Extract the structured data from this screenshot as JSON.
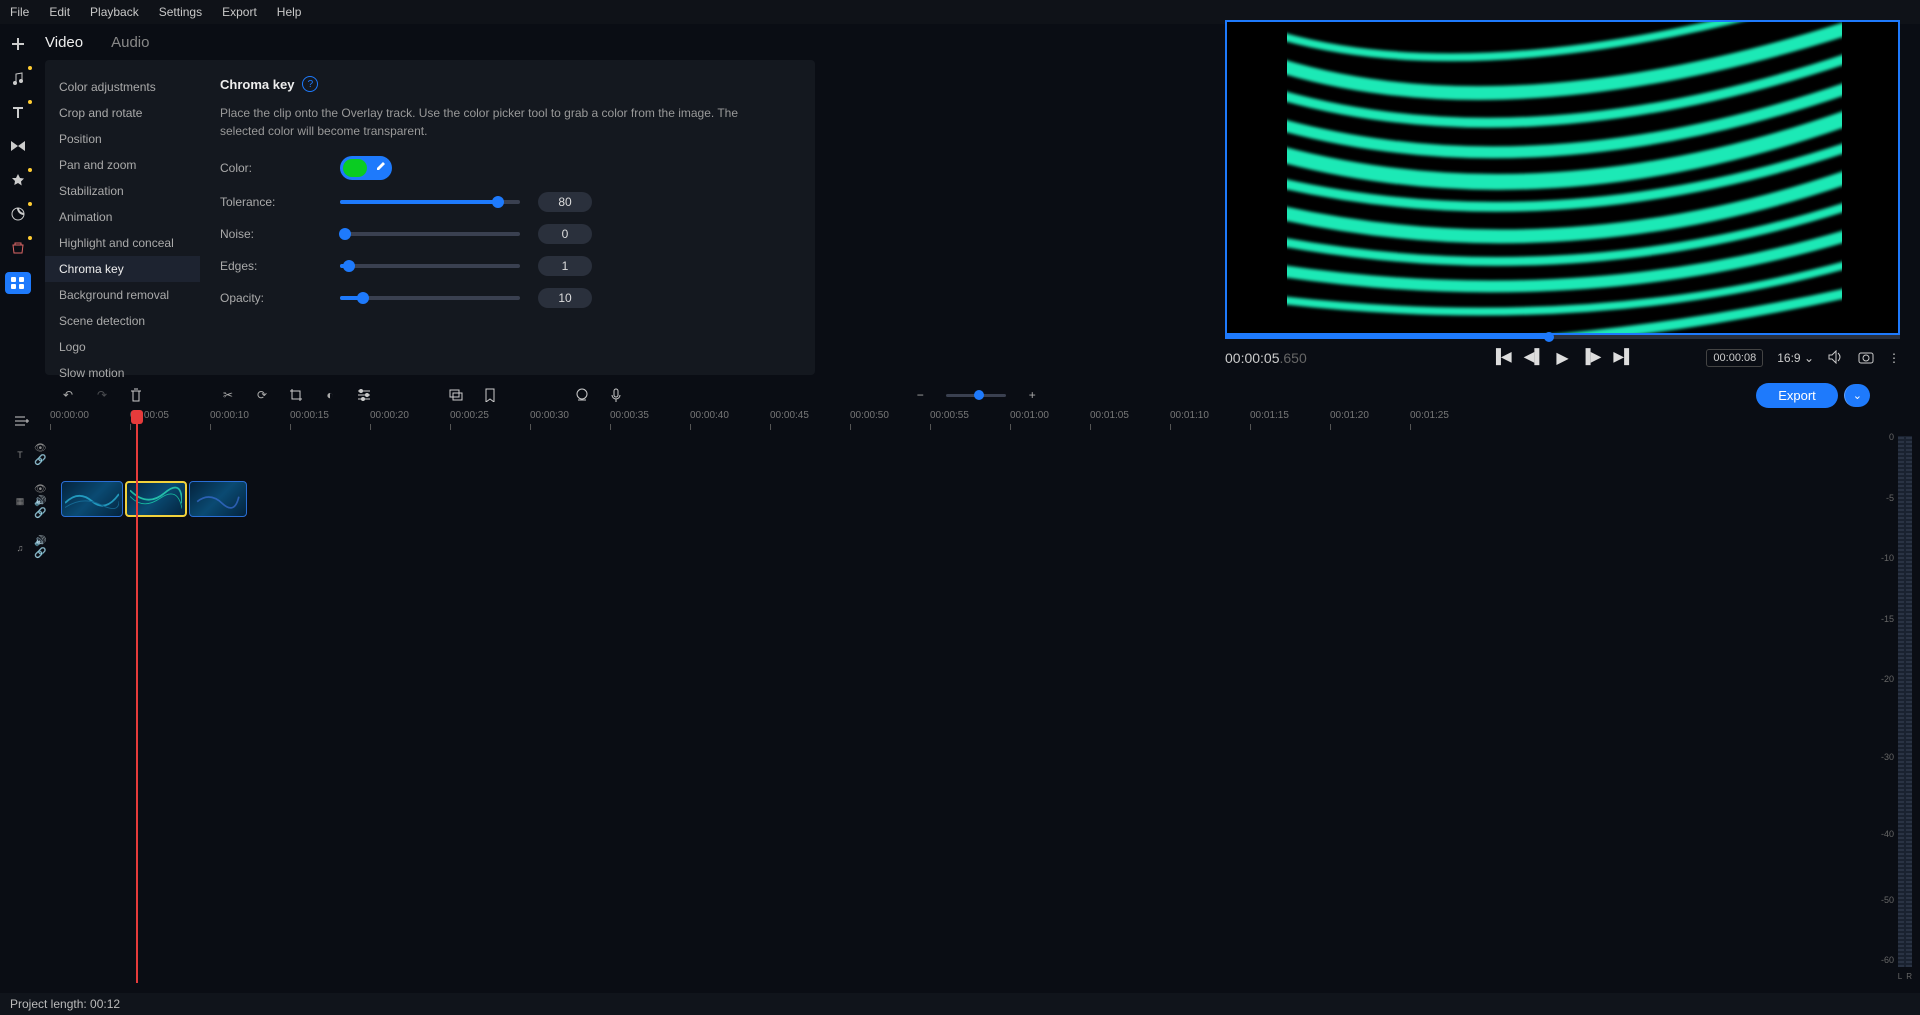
{
  "menubar": [
    "File",
    "Edit",
    "Playback",
    "Settings",
    "Export",
    "Help"
  ],
  "tabs": {
    "video": "Video",
    "audio": "Audio"
  },
  "sideItems": [
    "Color adjustments",
    "Crop and rotate",
    "Position",
    "Pan and zoom",
    "Stabilization",
    "Animation",
    "Highlight and conceal",
    "Chroma key",
    "Background removal",
    "Scene detection",
    "Logo",
    "Slow motion"
  ],
  "detail": {
    "title": "Chroma key",
    "desc": "Place the clip onto the Overlay track. Use the color picker tool to grab a color from the image. The selected color will become transparent.",
    "colorLabel": "Color:",
    "sliders": [
      {
        "label": "Tolerance:",
        "value": "80",
        "pct": 88
      },
      {
        "label": "Noise:",
        "value": "0",
        "pct": 3
      },
      {
        "label": "Edges:",
        "value": "1",
        "pct": 5
      },
      {
        "label": "Opacity:",
        "value": "10",
        "pct": 13
      }
    ]
  },
  "preview": {
    "timecode": "00:00:05",
    "timefrac": ".650",
    "progressPct": 48,
    "duration": "00:00:08",
    "ratio": "16:9"
  },
  "ruler": [
    "00:00:00",
    "00:00:05",
    "00:00:10",
    "00:00:15",
    "00:00:20",
    "00:00:25",
    "00:00:30",
    "00:00:35",
    "00:00:40",
    "00:00:45",
    "00:00:50",
    "00:00:55",
    "00:01:00",
    "00:01:05",
    "00:01:10",
    "00:01:15",
    "00:01:20",
    "00:01:25"
  ],
  "meter": [
    "0",
    "-5",
    "-10",
    "-15",
    "-20",
    "-30",
    "-40",
    "-50",
    "-60"
  ],
  "export": "Export",
  "status": "Project length: 00:12"
}
